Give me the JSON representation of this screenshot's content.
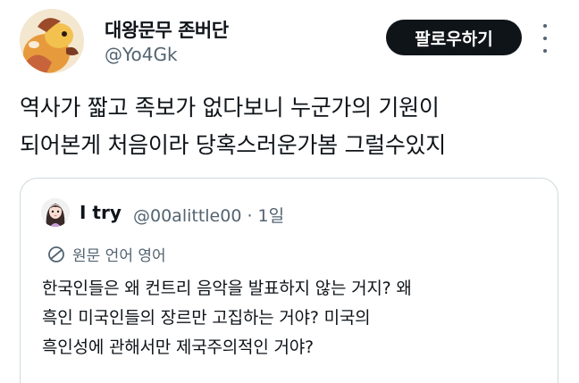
{
  "author": {
    "name": "대왕문무 존버단",
    "handle": "@Yo4Gk",
    "avatar_icon": "cartoon-character-avatar"
  },
  "actions": {
    "follow_label": "팔로우하기",
    "more_icon": "more-vertical-icon"
  },
  "tweet": {
    "lines": [
      "역사가 짧고 족보가 없다보니 누군가의 기원이",
      "되어본게 처음이라 당혹스러운가봄 그럴수있지"
    ]
  },
  "quote": {
    "name": "I try",
    "handle": "@00alittle00",
    "time": "· 1일",
    "translate_label": "원문 언어 영어",
    "translate_icon": "translate-globe-icon",
    "lines": [
      "한국인들은 왜 컨트리 음악을 발표하지 않는 거지? 왜",
      "흑인 미국인들의 장르만 고집하는 거야? 미국의",
      "흑인성에 관해서만 제국주의적인 거야?"
    ]
  },
  "colors": {
    "text": "#0f1419",
    "secondary": "#536471",
    "follow_bg": "#0f1419",
    "border": "#cfd9de"
  }
}
